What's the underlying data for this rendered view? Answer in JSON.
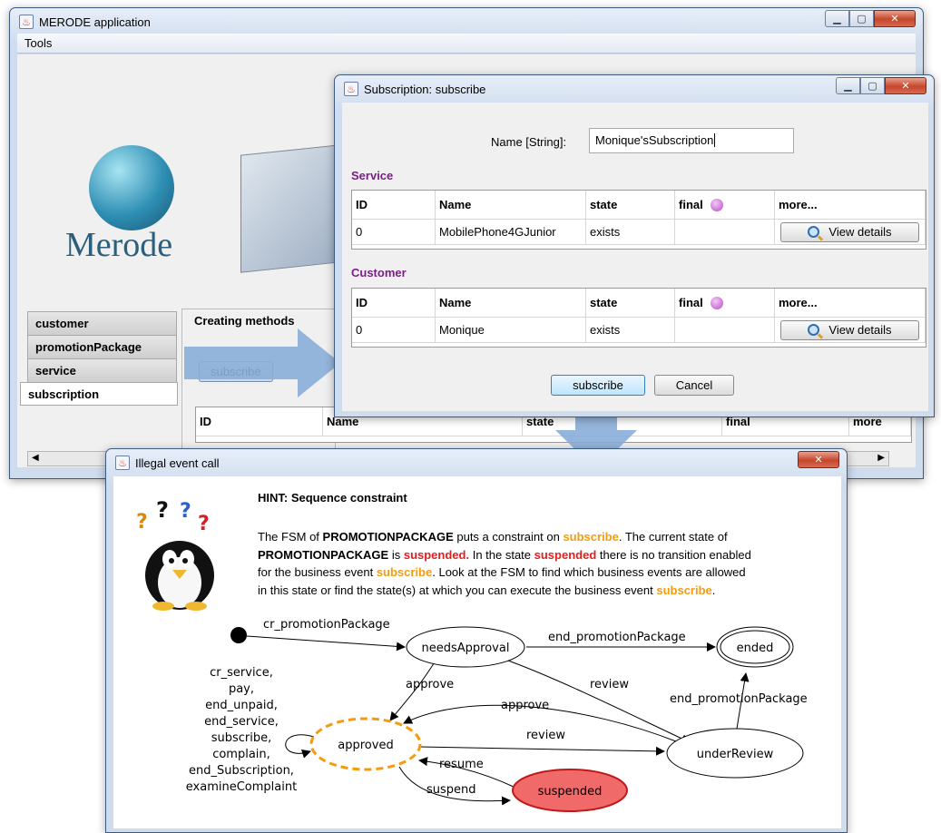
{
  "main_window": {
    "title": "MERODE application",
    "menu": [
      "Tools"
    ],
    "logo_text": "Merode",
    "object_tabs": [
      "customer",
      "promotionPackage",
      "service",
      "subscription"
    ],
    "section_title": "Creating methods",
    "method_button": "subscribe",
    "table_headers": [
      "ID",
      "Name",
      "state",
      "final",
      "more"
    ]
  },
  "dialog": {
    "title": "Subscription: subscribe",
    "name_label": "Name [String]:",
    "name_value": "Monique'sSubscription",
    "service_label": "Service",
    "customer_label": "Customer",
    "headers": [
      "ID",
      "Name",
      "state",
      "final",
      "more..."
    ],
    "service_row": {
      "id": "0",
      "name": "MobilePhone4GJunior",
      "state": "exists",
      "final": "",
      "action": "View details"
    },
    "customer_row": {
      "id": "0",
      "name": "Monique",
      "state": "exists",
      "final": "",
      "action": "View details"
    },
    "ok_button": "subscribe",
    "cancel_button": "Cancel"
  },
  "error_window": {
    "title": "Illegal event call",
    "hint_title": "HINT: Sequence constraint",
    "lines": [
      [
        {
          "t": "The FSM of "
        },
        {
          "t": "PROMOTIONPACKAGE",
          "c": "bold"
        },
        {
          "t": " puts a constraint on "
        },
        {
          "t": "subscribe",
          "c": "orange"
        },
        {
          "t": ".  The current state of"
        }
      ],
      [
        {
          "t": "PROMOTIONPACKAGE",
          "c": "bold"
        },
        {
          "t": " is "
        },
        {
          "t": "suspended.",
          "c": "red"
        },
        {
          "t": " In the state "
        },
        {
          "t": "suspended",
          "c": "red"
        },
        {
          "t": " there is no transition enabled"
        }
      ],
      [
        {
          "t": "for the business event "
        },
        {
          "t": "subscribe",
          "c": "orange"
        },
        {
          "t": ". Look at the FSM to find which business events are allowed"
        }
      ],
      [
        {
          "t": "in this state  or find the state(s) at which you can execute the business event "
        },
        {
          "t": "subscribe",
          "c": "orange"
        },
        {
          "t": "."
        }
      ]
    ],
    "fsm": {
      "states": {
        "needsApproval": "needsApproval",
        "ended": "ended",
        "approved": "approved",
        "underReview": "underReview",
        "suspended": "suspended"
      },
      "edges": {
        "cr_promotionPackage": "cr_promotionPackage",
        "end_promotionPackage_top": "end_promotionPackage",
        "end_promotionPackage_right": "end_promotionPackage",
        "approve_1": "approve",
        "review_1": "review",
        "approve_2": "approve",
        "review_2": "review",
        "resume": "resume",
        "suspend": "suspend"
      },
      "self_loop_events": [
        "cr_service,",
        "pay,",
        "end_unpaid,",
        "end_service,",
        "subscribe,",
        "complain,",
        "end_Subscription,",
        "examineComplaint"
      ]
    }
  },
  "colors": {
    "orange": "#f39c12",
    "red": "#e02020",
    "suspended_fill": "#f06a6a",
    "purple_label": "#7a1f86"
  }
}
